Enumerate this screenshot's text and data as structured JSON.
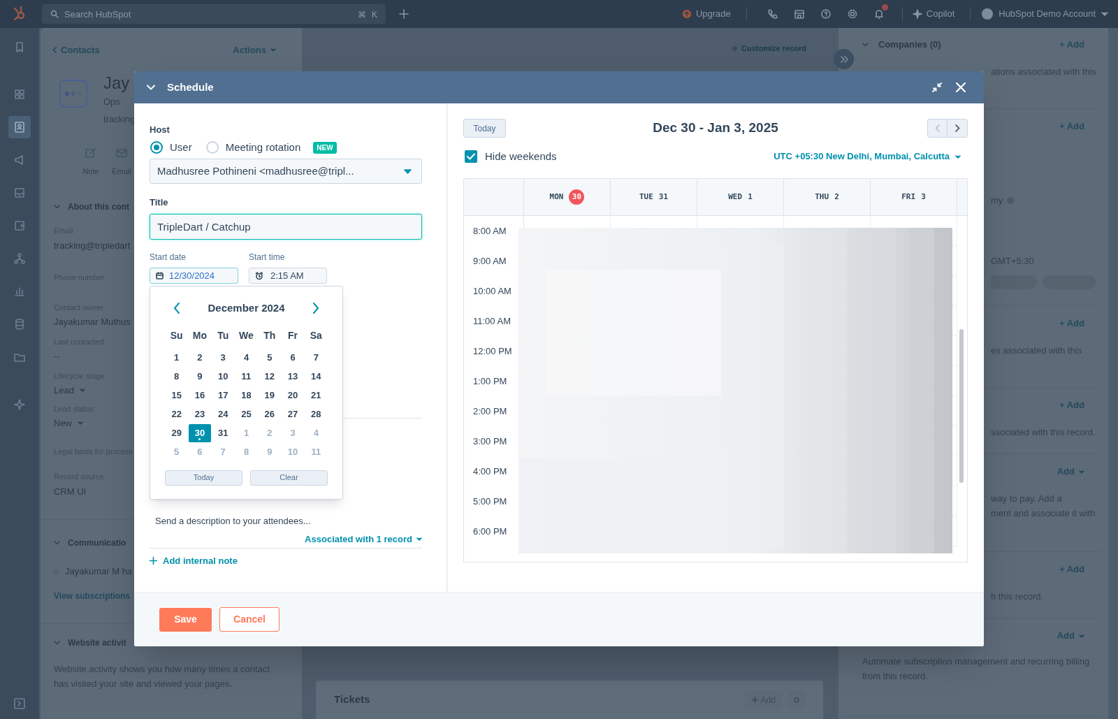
{
  "top_bar": {
    "search": {
      "placeholder": "Search HubSpot",
      "shortcut": [
        "⌘",
        "K"
      ]
    },
    "upgrade": "Upgrade",
    "copilot": "Copilot",
    "account": "HubSpot Demo Account"
  },
  "nav_rail": {
    "groups": [
      {
        "items": [
          {
            "kind": "bookmark",
            "selected": false
          }
        ]
      },
      {
        "items": [
          {
            "kind": "grid",
            "selected": false
          },
          {
            "kind": "contacts",
            "selected": true
          },
          {
            "kind": "megaphone",
            "selected": false
          },
          {
            "kind": "inbox",
            "selected": false
          },
          {
            "kind": "document",
            "selected": false
          },
          {
            "kind": "network",
            "selected": false
          },
          {
            "kind": "chart",
            "selected": false
          },
          {
            "kind": "database",
            "selected": false
          },
          {
            "kind": "folder",
            "selected": false
          }
        ]
      },
      {
        "items": [
          {
            "kind": "sparkle",
            "selected": false
          }
        ]
      }
    ]
  },
  "record": {
    "back": "Contacts",
    "actions": "Actions",
    "name": "Jay",
    "job": "Ops",
    "email": "tracking",
    "quick_actions": [
      {
        "kind": "note",
        "label": "Note"
      },
      {
        "kind": "email",
        "label": "Email"
      }
    ],
    "about": {
      "title": "About this cont",
      "fields": [
        {
          "label": "Email",
          "value": "tracking@tripledart",
          "dropdown": false
        },
        {
          "label": "Phone number"
        },
        {
          "label": "Contact owner",
          "value": "Jayakumar Muthus",
          "dropdown": false
        },
        {
          "label": "Last contacted",
          "value": "--",
          "dropdown": false
        },
        {
          "label": "Lifecycle stage",
          "value": "Lead",
          "dropdown": true
        },
        {
          "label": "Lead status",
          "value": "New",
          "dropdown": true
        },
        {
          "label": "Legal basis for process"
        },
        {
          "label": "Record source",
          "value": "CRM UI",
          "dropdown": false
        }
      ]
    },
    "communication": {
      "title": "Communicatio",
      "item": "Jayakumar M ha",
      "link": "View subscriptions"
    },
    "website": {
      "title": "Website activit",
      "description": "Website activity shows you how many times a contact has visited your site and viewed your pages."
    }
  },
  "center": {
    "customize": "Customize record",
    "tickets": {
      "title": "Tickets",
      "action": "Add"
    }
  },
  "right_panel": {
    "sections": [
      {
        "title": "Companies (0)",
        "action": "+ Add",
        "lines": [
          {
            "kind": "text",
            "text": "ations associated with this"
          }
        ]
      },
      {
        "action": "+ Add",
        "lines": [
          {
            "kind": "info",
            "text": "my"
          },
          {
            "kind": "text",
            "text": "GMT+5:30"
          },
          {
            "kind": "pills"
          }
        ]
      },
      {
        "action": "+ Add",
        "lines": [
          {
            "kind": "text",
            "text": "es associated with this"
          }
        ]
      },
      {
        "action": "+ Add",
        "lines": [
          {
            "kind": "text",
            "text": "ssociated with this record."
          }
        ]
      },
      {
        "action": "Add",
        "lines": [
          {
            "kind": "text",
            "text": "way to pay. Add a"
          },
          {
            "kind": "text",
            "text": "ment and associate it with"
          }
        ]
      },
      {
        "action": "+ Add",
        "lines": [
          {
            "kind": "text",
            "text": "h this record."
          }
        ]
      },
      {
        "action": "Add",
        "lines": [
          {
            "kind": "full",
            "text": "Automate subscription management and recurring billing from this record."
          }
        ]
      }
    ]
  },
  "modal": {
    "title": "Schedule",
    "host": {
      "label": "Host",
      "options": [
        {
          "label": "User",
          "selected": true
        },
        {
          "label": "Meeting rotation",
          "selected": false,
          "badge": "NEW"
        }
      ],
      "value": "Madhusree Pothineni <madhusree@tripl..."
    },
    "title_field": {
      "label": "Title",
      "value": "TripleDart / Catchup"
    },
    "start_date": {
      "label": "Start date",
      "value": "12/30/2024"
    },
    "start_time": {
      "label": "Start time",
      "value": "2:15 AM"
    },
    "description": {
      "placeholder": "Send a description to your attendees..."
    },
    "associated": "Associated with 1 record",
    "add_note": "Add internal note",
    "buttons": {
      "save": "Save",
      "cancel": "Cancel"
    },
    "date_picker": {
      "month": "December 2024",
      "weekdays": [
        "Su",
        "Mo",
        "Tu",
        "We",
        "Th",
        "Fr",
        "Sa"
      ],
      "days": [
        {
          "label": "1",
          "muted": false,
          "selected": false,
          "today": false
        },
        {
          "label": "2",
          "muted": false,
          "selected": false,
          "today": false
        },
        {
          "label": "3",
          "muted": false,
          "selected": false,
          "today": false
        },
        {
          "label": "4",
          "muted": false,
          "selected": false,
          "today": false
        },
        {
          "label": "5",
          "muted": false,
          "selected": false,
          "today": false
        },
        {
          "label": "6",
          "muted": false,
          "selected": false,
          "today": false
        },
        {
          "label": "7",
          "muted": false,
          "selected": false,
          "today": false
        },
        {
          "label": "8",
          "muted": false,
          "selected": false,
          "today": false
        },
        {
          "label": "9",
          "muted": false,
          "selected": false,
          "today": false
        },
        {
          "label": "10",
          "muted": false,
          "selected": false,
          "today": false
        },
        {
          "label": "11",
          "muted": false,
          "selected": false,
          "today": false
        },
        {
          "label": "12",
          "muted": false,
          "selected": false,
          "today": false
        },
        {
          "label": "13",
          "muted": false,
          "selected": false,
          "today": false
        },
        {
          "label": "14",
          "muted": false,
          "selected": false,
          "today": false
        },
        {
          "label": "15",
          "muted": false,
          "selected": false,
          "today": false
        },
        {
          "label": "16",
          "muted": false,
          "selected": false,
          "today": false
        },
        {
          "label": "17",
          "muted": false,
          "selected": false,
          "today": false
        },
        {
          "label": "18",
          "muted": false,
          "selected": false,
          "today": false
        },
        {
          "label": "19",
          "muted": false,
          "selected": false,
          "today": false
        },
        {
          "label": "20",
          "muted": false,
          "selected": false,
          "today": false
        },
        {
          "label": "21",
          "muted": false,
          "selected": false,
          "today": false
        },
        {
          "label": "22",
          "muted": false,
          "selected": false,
          "today": false
        },
        {
          "label": "23",
          "muted": false,
          "selected": false,
          "today": false
        },
        {
          "label": "24",
          "muted": false,
          "selected": false,
          "today": false
        },
        {
          "label": "25",
          "muted": false,
          "selected": false,
          "today": false
        },
        {
          "label": "26",
          "muted": false,
          "selected": false,
          "today": false
        },
        {
          "label": "27",
          "muted": false,
          "selected": false,
          "today": false
        },
        {
          "label": "28",
          "muted": false,
          "selected": false,
          "today": false
        },
        {
          "label": "29",
          "muted": false,
          "selected": false,
          "today": false
        },
        {
          "label": "30",
          "muted": false,
          "selected": true,
          "today": true
        },
        {
          "label": "31",
          "muted": false,
          "selected": false,
          "today": false
        },
        {
          "label": "1",
          "muted": true,
          "selected": false,
          "today": false
        },
        {
          "label": "2",
          "muted": true,
          "selected": false,
          "today": false
        },
        {
          "label": "3",
          "muted": true,
          "selected": false,
          "today": false
        },
        {
          "label": "4",
          "muted": true,
          "selected": false,
          "today": false
        },
        {
          "label": "5",
          "muted": true,
          "selected": false,
          "today": false
        },
        {
          "label": "6",
          "muted": true,
          "selected": false,
          "today": false
        },
        {
          "label": "7",
          "muted": true,
          "selected": false,
          "today": false
        },
        {
          "label": "8",
          "muted": true,
          "selected": false,
          "today": false
        },
        {
          "label": "9",
          "muted": true,
          "selected": false,
          "today": false
        },
        {
          "label": "10",
          "muted": true,
          "selected": false,
          "today": false
        },
        {
          "label": "11",
          "muted": true,
          "selected": false,
          "today": false
        }
      ],
      "today_button": "Today",
      "clear_button": "Clear"
    },
    "calendar": {
      "today_button": "Today",
      "range": "Dec 30 - Jan 3, 2025",
      "hide_weekends": {
        "label": "Hide weekends",
        "checked": true
      },
      "timezone": "UTC +05:30 New Delhi, Mumbai, Calcutta",
      "days": [
        {
          "weekday": "MON",
          "date": "30",
          "today": true
        },
        {
          "weekday": "TUE",
          "date": "31",
          "today": false
        },
        {
          "weekday": "WED",
          "date": "1",
          "today": false
        },
        {
          "weekday": "THU",
          "date": "2",
          "today": false
        },
        {
          "weekday": "FRI",
          "date": "3",
          "today": false
        }
      ],
      "hours": [
        "8:00 AM",
        "9:00 AM",
        "10:00 AM",
        "11:00 AM",
        "12:00 PM",
        "1:00 PM",
        "2:00 PM",
        "3:00 PM",
        "4:00 PM",
        "5:00 PM",
        "6:00 PM"
      ]
    }
  }
}
